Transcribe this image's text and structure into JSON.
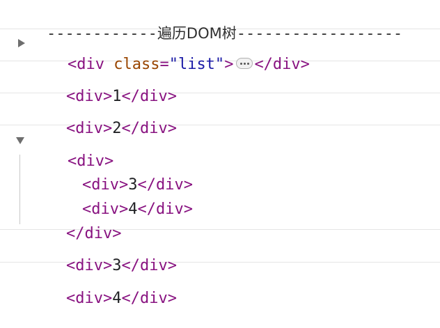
{
  "header": {
    "dashes_left": "------------",
    "title": "遍历DOM树",
    "dashes_right": "------------------"
  },
  "rows": [
    {
      "open_tag": "<div",
      "attr_name": " class",
      "attr_eq": "=",
      "attr_value": "\"list\"",
      "open_end": ">",
      "close_tag": "</div>"
    },
    {
      "open": "<div>",
      "text": "1",
      "close": "</div>"
    },
    {
      "open": "<div>",
      "text": "2",
      "close": "</div>"
    },
    {
      "open": "<div>",
      "children": [
        {
          "open": "<div>",
          "text": "3",
          "close": "</div>"
        },
        {
          "open": "<div>",
          "text": "4",
          "close": "</div>"
        }
      ],
      "close": "</div>"
    },
    {
      "open": "<div>",
      "text": "3",
      "close": "</div>"
    },
    {
      "open": "<div>",
      "text": "4",
      "close": "</div>"
    }
  ],
  "icons": {
    "collapsed": "disclosure-triangle-right",
    "expanded": "disclosure-triangle-down",
    "more": "ellipsis-badge"
  },
  "colors": {
    "tag": "#881280",
    "attr_name": "#994500",
    "attr_value": "#1a1aa6",
    "text": "#202124",
    "divider": "#e5e5e5"
  }
}
